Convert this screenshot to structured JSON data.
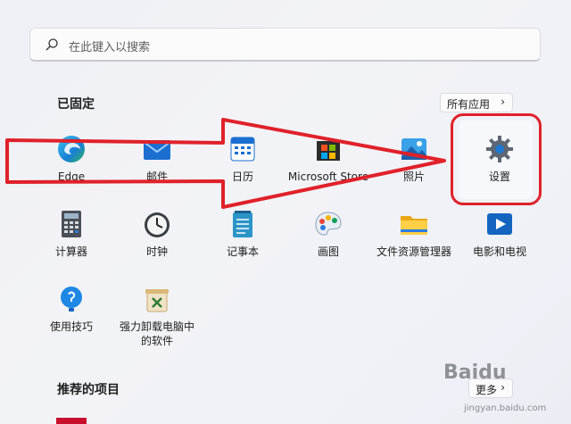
{
  "search": {
    "placeholder": "在此键入以搜索"
  },
  "pinned": {
    "title": "已固定",
    "all_apps_label": "所有应用",
    "apps": [
      {
        "label": "Edge",
        "icon": "edge-icon"
      },
      {
        "label": "邮件",
        "icon": "mail-icon"
      },
      {
        "label": "日历",
        "icon": "calendar-icon"
      },
      {
        "label": "Microsoft Store",
        "icon": "store-icon"
      },
      {
        "label": "照片",
        "icon": "photos-icon"
      },
      {
        "label": "设置",
        "icon": "gear-icon"
      },
      {
        "label": "计算器",
        "icon": "calculator-icon"
      },
      {
        "label": "时钟",
        "icon": "clock-icon"
      },
      {
        "label": "记事本",
        "icon": "notepad-icon"
      },
      {
        "label": "画图",
        "icon": "paint-icon"
      },
      {
        "label": "文件资源管理器",
        "icon": "folder-icon"
      },
      {
        "label": "电影和电视",
        "icon": "movies-icon"
      },
      {
        "label": "使用技巧",
        "icon": "tips-icon"
      },
      {
        "label": "强力卸载电脑中",
        "label_line2": "的软件",
        "icon": "uninstall-icon"
      }
    ]
  },
  "recommended": {
    "title": "推荐的项目",
    "more_label": "更多"
  },
  "watermark": {
    "brand": "Baidu",
    "url": "jingyan.baidu.com"
  },
  "colors": {
    "annotation_red": "#e0212a",
    "accent_blue": "#0067c0"
  }
}
